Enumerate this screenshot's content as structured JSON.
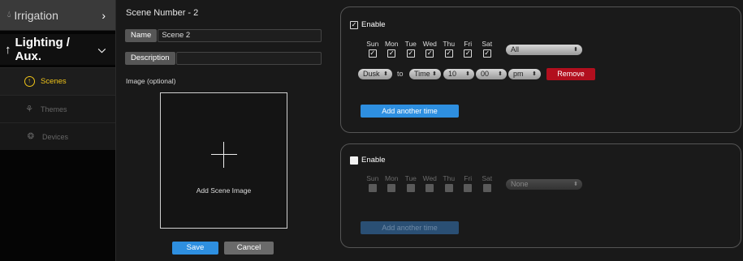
{
  "sidebar": {
    "irrigation": "Irrigation",
    "lighting": "Lighting / Aux.",
    "items": [
      {
        "label": "Scenes",
        "icon": "scene-icon",
        "active": true
      },
      {
        "label": "Themes",
        "icon": "themes-icon",
        "active": false
      },
      {
        "label": "Devices",
        "icon": "bulb-icon",
        "active": false
      }
    ]
  },
  "form": {
    "scene_title": "Scene Number - 2",
    "name_label": "Name",
    "name_value": "Scene 2",
    "description_label": "Description",
    "description_value": "",
    "image_label": "Image (optional)",
    "add_image_text": "Add Scene Image",
    "save_label": "Save",
    "cancel_label": "Cancel"
  },
  "schedules": [
    {
      "enable_label": "Enable",
      "enabled": true,
      "days": [
        "Sun",
        "Mon",
        "Tue",
        "Wed",
        "Thu",
        "Fri",
        "Sat"
      ],
      "day_selector": "All",
      "start": "Dusk",
      "to_label": "to",
      "end_type": "Time",
      "hour": "10",
      "minute": "00",
      "ampm": "pm",
      "remove_label": "Remove",
      "add_label": "Add another time"
    },
    {
      "enable_label": "Enable",
      "enabled": false,
      "days": [
        "Sun",
        "Mon",
        "Tue",
        "Wed",
        "Thu",
        "Fri",
        "Sat"
      ],
      "day_selector": "None",
      "add_label": "Add another time"
    }
  ],
  "colors": {
    "accent_blue": "#2e8fe0",
    "remove_red": "#b20f1e",
    "active_yellow": "#f0c419"
  }
}
